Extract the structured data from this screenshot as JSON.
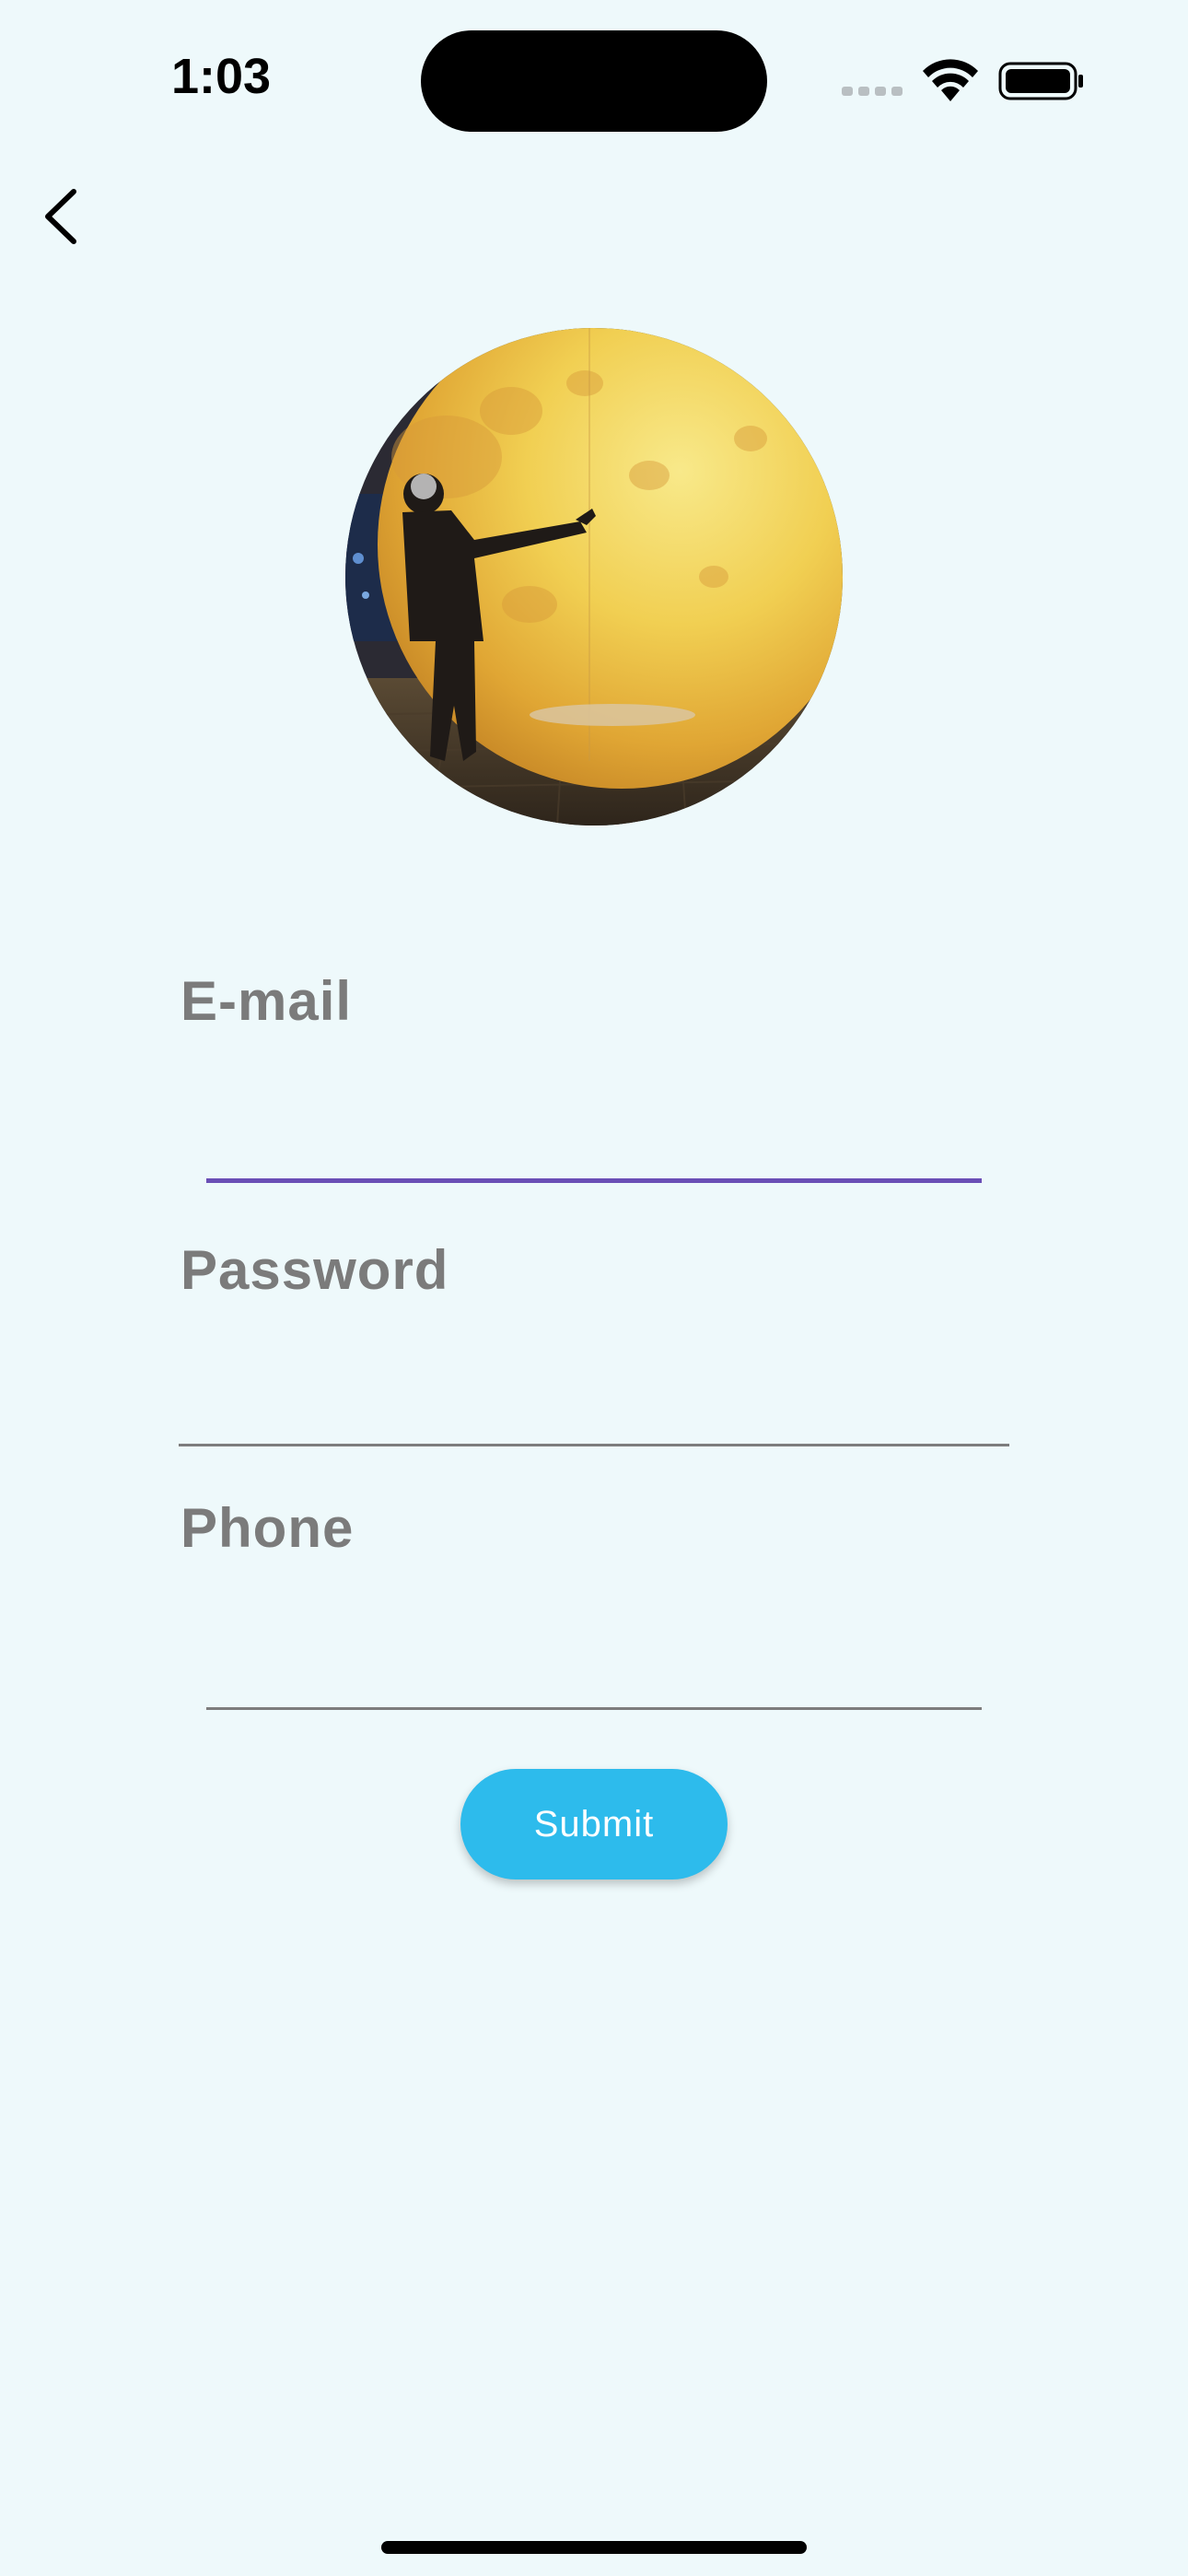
{
  "status_bar": {
    "time": "1:03"
  },
  "nav": {
    "back_icon": "chevron-left-icon"
  },
  "profile": {
    "avatar_description": ""
  },
  "form": {
    "email": {
      "label": "E-mail",
      "value": "",
      "placeholder": ""
    },
    "password": {
      "label": "Password",
      "value": "",
      "placeholder": ""
    },
    "phone": {
      "label": "Phone",
      "value": "",
      "placeholder": ""
    },
    "submit_label": "Submit"
  },
  "colors": {
    "background": "#eef9fb",
    "accent": "#2dbbec",
    "focus_underline": "#6a4fb6",
    "label_gray": "#7b7b7b"
  }
}
